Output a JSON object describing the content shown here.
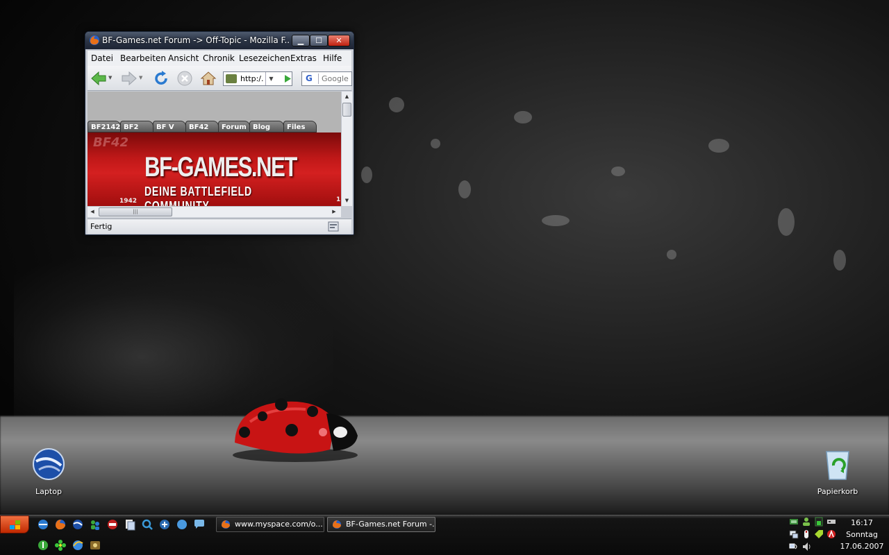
{
  "browser": {
    "title": "BF-Games.net Forum -> Off-Topic - Mozilla F...",
    "menu": [
      "Datei",
      "Bearbeiten",
      "Ansicht",
      "Chronik",
      "Lesezeichen",
      "Extras",
      "Hilfe"
    ],
    "url": "http:/.",
    "search_placeholder": "Google",
    "status": "Fertig",
    "page": {
      "tabs": [
        "BF2142",
        "BF2",
        "BF V",
        "BF42",
        "Forum",
        "Blog",
        "Files"
      ],
      "banner_bg_text": "BF42",
      "site_name": "BF-GAMES.NET",
      "tagline": "DEINE  BATTLEFIELD  COMMUNITY",
      "banner_year": "1942",
      "banner_edge_digit": "1"
    }
  },
  "desktop_icons": {
    "laptop": "Laptop",
    "recycle": "Papierkorb"
  },
  "taskbar": {
    "tasks": [
      {
        "label": "www.myspace.com/o...",
        "active": false
      },
      {
        "label": "BF-Games.net Forum -...",
        "active": true
      }
    ],
    "clock": {
      "time": "16:17",
      "day": "Sonntag",
      "date": "17.06.2007"
    }
  },
  "colors": {
    "accent_red": "#c01818",
    "taskbar": "#0a0a0a",
    "window_frame": "#2c3546"
  }
}
